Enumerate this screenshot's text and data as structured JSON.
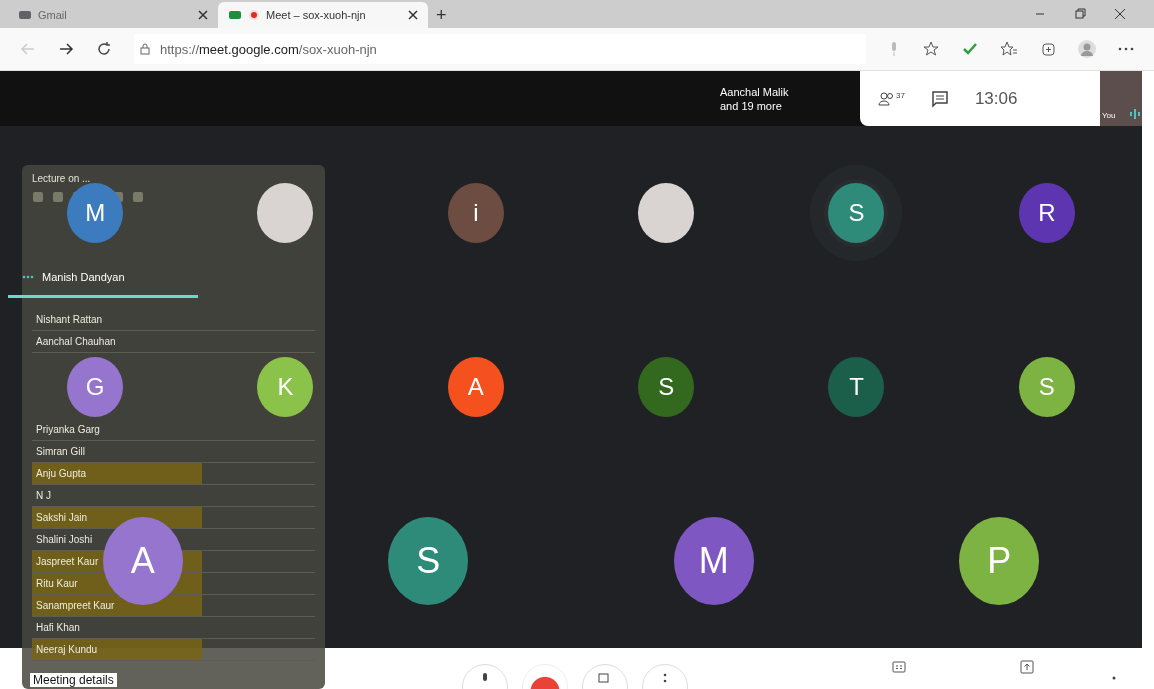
{
  "browser": {
    "tabs": [
      {
        "title": "Gmail",
        "selected": false,
        "recording": false
      },
      {
        "title": "Meet – sox-xuoh-njn",
        "selected": true,
        "recording": true
      }
    ],
    "new_tab": "+",
    "url": {
      "scheme": "https://",
      "host": "meet.google.com",
      "path": "/sox-xuoh-njn"
    }
  },
  "meet_header": {
    "speaker_notice": [
      "Aanchal Malik",
      "and 19 more"
    ],
    "participants_count": "37",
    "time": "13:06",
    "self_label": "You"
  },
  "speaking_label": "Manish Dandyan",
  "tile_rows": [
    [
      {
        "kind": "initial",
        "letter": "M",
        "color": "#3d7bbf",
        "speaking": false
      },
      {
        "kind": "photo",
        "speaking": false
      },
      {
        "kind": "initial",
        "letter": "i",
        "color": "#6d4c41",
        "speaking": false
      },
      {
        "kind": "photo",
        "speaking": false
      },
      {
        "kind": "initial",
        "letter": "S",
        "color": "#2e8b7a",
        "speaking": true
      },
      {
        "kind": "initial",
        "letter": "R",
        "color": "#5e35b1",
        "speaking": false
      }
    ],
    [
      {
        "kind": "initial",
        "letter": "G",
        "color": "#9575cd",
        "speaking": false
      },
      {
        "kind": "initial",
        "letter": "K",
        "color": "#8bc34a",
        "speaking": false
      },
      {
        "kind": "initial",
        "letter": "A",
        "color": "#f4511e",
        "speaking": false
      },
      {
        "kind": "initial",
        "letter": "S",
        "color": "#33691e",
        "speaking": false
      },
      {
        "kind": "initial",
        "letter": "T",
        "color": "#1b5e4a",
        "speaking": false
      },
      {
        "kind": "initial",
        "letter": "S",
        "color": "#7cb342",
        "speaking": false
      }
    ],
    [
      {
        "kind": "initial",
        "letter": "A",
        "color": "#9575cd",
        "speaking": false
      },
      {
        "kind": "initial",
        "letter": "S",
        "color": "#2e8b7a",
        "speaking": false
      },
      {
        "kind": "initial",
        "letter": "M",
        "color": "#7e57c2",
        "speaking": false
      },
      {
        "kind": "initial",
        "letter": "P",
        "color": "#7cb342",
        "speaking": false
      }
    ]
  ],
  "attendance_panel": {
    "title": "Lecture on ...",
    "rows": [
      {
        "name": "Nishant Rattan",
        "highlighted": false
      },
      {
        "name": "Aanchal Chauhan",
        "highlighted": false
      },
      {
        "name": "Priyanka Garg",
        "highlighted": false
      },
      {
        "name": "Simran Gill",
        "highlighted": false
      },
      {
        "name": "Anju Gupta",
        "highlighted": true
      },
      {
        "name": "N J",
        "highlighted": false
      },
      {
        "name": "Sakshi Jain",
        "highlighted": true
      },
      {
        "name": "Shalini Joshi",
        "highlighted": false
      },
      {
        "name": "Jaspreet Kaur",
        "highlighted": true
      },
      {
        "name": "Ritu Kaur",
        "highlighted": true
      },
      {
        "name": "Sanampreet Kaur",
        "highlighted": true
      },
      {
        "name": "Hafi Khan",
        "highlighted": false
      },
      {
        "name": "Neeraj Kundu",
        "highlighted": true
      }
    ]
  },
  "meeting_details": "Meeting details"
}
